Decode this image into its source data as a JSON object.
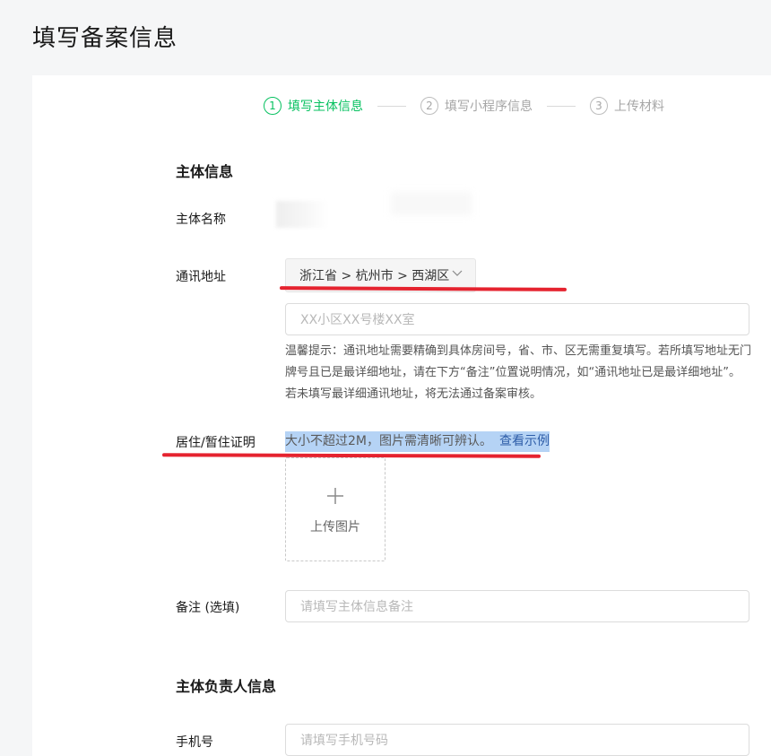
{
  "page": {
    "title": "填写备案信息"
  },
  "steps": [
    {
      "num": "1",
      "label": "填写主体信息",
      "active": true
    },
    {
      "num": "2",
      "label": "填写小程序信息",
      "active": false
    },
    {
      "num": "3",
      "label": "上传材料",
      "active": false
    }
  ],
  "subject_info": {
    "section_title": "主体信息",
    "name_label": "主体名称",
    "address_label": "通讯地址",
    "region_value": "浙江省 > 杭州市 > 西湖区",
    "address_placeholder": "XX小区XX号楼XX室",
    "tip": "温馨提示：通讯地址需要精确到具体房间号，省、市、区无需重复填写。若所填写地址无门牌号且已是最详细地址，请在下方“备注”位置说明情况，如“通讯地址已是最详细地址”。若未填写最详细通讯地址，将无法通过备案审核。",
    "residence_label": "居住/暂住证明",
    "upload_hint": "大小不超过2M，图片需清晰可辨认。",
    "upload_example_link": "查看示例",
    "upload_button_label": "上传图片",
    "remark_label": "备注 (选填)",
    "remark_placeholder": "请填写主体信息备注"
  },
  "owner_info": {
    "section_title": "主体负责人信息",
    "phone_label": "手机号",
    "phone_placeholder": "请填写手机号码"
  },
  "colors": {
    "accent": "#07c160",
    "annotation_red": "#e5232f",
    "link": "#2e5da8",
    "highlight": "#b5d3f5"
  }
}
